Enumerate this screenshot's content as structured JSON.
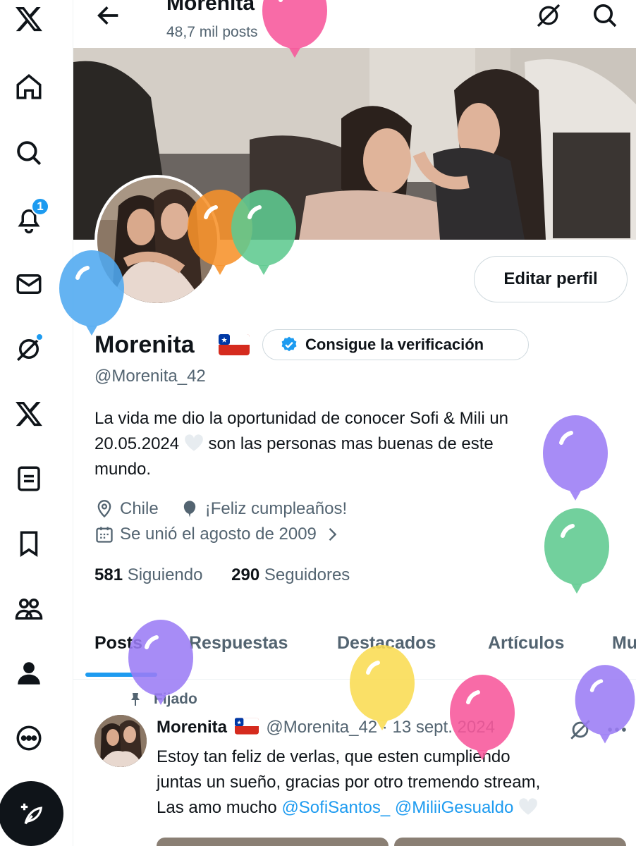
{
  "nav": {
    "notifications_badge": "1"
  },
  "header": {
    "title": "Morenita",
    "post_count": "48,7 mil posts"
  },
  "profile": {
    "edit_button": "Editar perfil",
    "display_name": "Morenita",
    "verify_label": "Consigue la verificación",
    "handle": "@Morenita_42",
    "bio_line1": "La vida me dio la oportunidad de conocer Sofi & Mili un",
    "bio_line2_pre": "20.05.2024",
    "bio_line2_post": "son las personas mas buenas de este",
    "bio_line3": "mundo.",
    "location": "Chile",
    "birthday": "¡Feliz cumpleaños!",
    "joined": "Se unió el agosto de 2009",
    "following_count": "581",
    "following_label": "Siguiendo",
    "followers_count": "290",
    "followers_label": "Seguidores"
  },
  "tabs": [
    "Posts",
    "Respuestas",
    "Destacados",
    "Artículos",
    "Mu"
  ],
  "pinned_tweet": {
    "pinned_label": "Fijado",
    "author": "Morenita",
    "handle_date": "@Morenita_42 · 13 sept. 2024",
    "line1": "Estoy tan feliz de verlas, que esten cumpliendo",
    "line2": "juntas un sueño, gracias por otro tremendo stream,",
    "line3_pre": "Las amo mucho",
    "mention1": "@SofiSantos_",
    "mention2": "@MiliiGesualdo"
  },
  "colors": {
    "accent": "#1d9bf0",
    "text": "#0f1419",
    "muted": "#536471",
    "balloon_pink": "#f7579b",
    "balloon_orange": "#f7922a",
    "balloon_green": "#5ec98f",
    "balloon_blue": "#4fa8f0",
    "balloon_purple": "#9b7cf5",
    "balloon_yellow": "#f9dc52"
  }
}
